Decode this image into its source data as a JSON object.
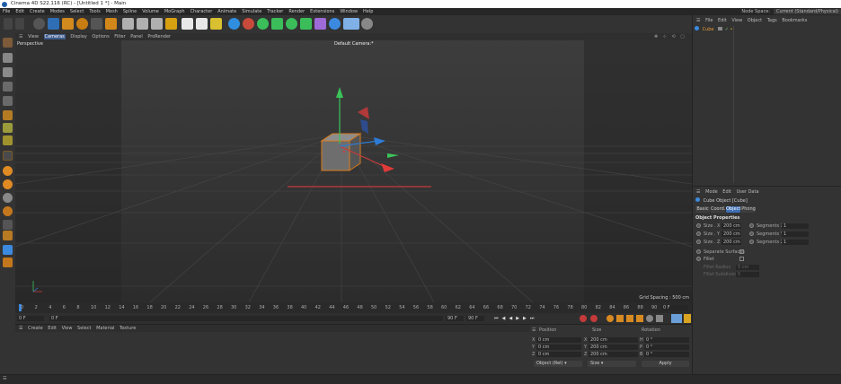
{
  "window": {
    "title": "Cinema 4D S22.116 (RC) - [Untitled 1 *] - Main"
  },
  "menu": [
    "File",
    "Edit",
    "Create",
    "Modes",
    "Select",
    "Tools",
    "Mesh",
    "Spline",
    "Volume",
    "MoGraph",
    "Character",
    "Animate",
    "Simulate",
    "Tracker",
    "Render",
    "Extensions",
    "Window",
    "Help"
  ],
  "node_space": {
    "label": "Node Space:",
    "value": "Current (Standard/Physical)"
  },
  "viewport": {
    "menu": [
      "View",
      "Cameras",
      "Display",
      "Options",
      "Filter",
      "Panel",
      "ProRender"
    ],
    "active_menu": "Cameras",
    "name": "Perspective",
    "camera": "Default Camera:*",
    "grid_spacing": "Grid Spacing : 500 cm"
  },
  "timeline": {
    "ticks": [
      "0",
      "2",
      "4",
      "6",
      "8",
      "10",
      "12",
      "14",
      "16",
      "18",
      "20",
      "22",
      "24",
      "26",
      "28",
      "30",
      "32",
      "34",
      "36",
      "38",
      "40",
      "42",
      "44",
      "46",
      "48",
      "50",
      "52",
      "54",
      "56",
      "58",
      "60",
      "62",
      "64",
      "66",
      "68",
      "70",
      "72",
      "74",
      "76",
      "78",
      "80",
      "82",
      "84",
      "86",
      "88",
      "90"
    ],
    "frame_display": "0 F"
  },
  "transport": {
    "start": "0 F",
    "current": "0 F",
    "end": "90 F",
    "end2": "90 F"
  },
  "material_menu": [
    "Create",
    "Edit",
    "View",
    "Select",
    "Material",
    "Texture"
  ],
  "coords": {
    "headers": [
      "Position",
      "Size",
      "Rotation"
    ],
    "rows": [
      {
        "axis": "X",
        "pos": "0 cm",
        "size_axis": "X",
        "size": "200 cm",
        "rot_axis": "H",
        "rot": "0 °"
      },
      {
        "axis": "Y",
        "pos": "0 cm",
        "size_axis": "Y",
        "size": "200 cm",
        "rot_axis": "P",
        "rot": "0 °"
      },
      {
        "axis": "Z",
        "pos": "0 cm",
        "size_axis": "Z",
        "size": "200 cm",
        "rot_axis": "B",
        "rot": "0 °"
      }
    ],
    "mode": "Object (Rel)",
    "size_mode": "Size",
    "apply": "Apply"
  },
  "objects": {
    "menu": [
      "File",
      "Edit",
      "View",
      "Object",
      "Tags",
      "Bookmarks"
    ],
    "items": [
      {
        "name": "Cube"
      }
    ]
  },
  "attributes": {
    "menu": [
      "Mode",
      "Edit",
      "User Data"
    ],
    "title": "Cube Object [Cube]",
    "tabs": [
      "Basic",
      "Coord.",
      "Object",
      "Phong"
    ],
    "active_tab": "Object",
    "section": "Object Properties",
    "size_fields": [
      {
        "label": "Size . X",
        "value": "200 cm"
      },
      {
        "label": "Size . Y",
        "value": "200 cm"
      },
      {
        "label": "Size . Z",
        "value": "200 cm"
      }
    ],
    "seg_fields": [
      {
        "label": "Segments X",
        "value": "1"
      },
      {
        "label": "Segments Y",
        "value": "1"
      },
      {
        "label": "Segments Z",
        "value": "1"
      }
    ],
    "separate": "Separate Surfaces",
    "fillet": "Fillet",
    "fillet_radius": {
      "label": "Fillet Radius",
      "value": "5 cm"
    },
    "fillet_sub": {
      "label": "Fillet Subdivision",
      "value": "5"
    }
  }
}
